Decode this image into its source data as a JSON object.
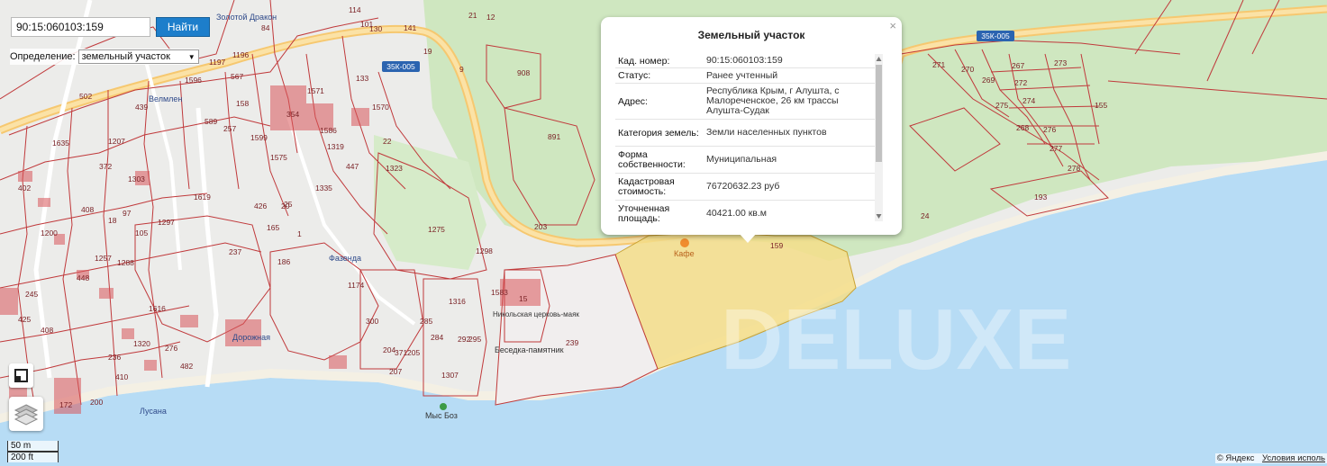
{
  "search": {
    "value": "90:15:060103:159",
    "button_label": "Найти"
  },
  "define": {
    "label": "Определение:",
    "selected": "земельный участок"
  },
  "popup": {
    "title": "Земельный участок",
    "close_symbol": "×",
    "rows": [
      {
        "label": "Кад. номер:",
        "value": "90:15:060103:159"
      },
      {
        "label": "Статус:",
        "value": "Ранее учтенный"
      },
      {
        "label": "Адрес:",
        "value": "Республика Крым, г Алушта, с Малореченское, 26 км трассы Алушта-Судак"
      },
      {
        "label": "Категория земель:",
        "value": "Земли населенных пунктов"
      },
      {
        "label": "Форма собственности:",
        "value": "Муниципальная"
      },
      {
        "label": "Кадастровая стоимость:",
        "value": "76720632.23 руб"
      },
      {
        "label": "Уточненная площадь:",
        "value": "40421.00 кв.м"
      }
    ]
  },
  "scale": {
    "metric": "50 m",
    "imperial": "200 ft"
  },
  "copyright": {
    "yandex": "© Яндекс",
    "terms": "Условия исполь"
  },
  "watermark": "DELUXE",
  "map_labels": {
    "roads": [
      "35К-005",
      "35К-005",
      "35К-005"
    ],
    "pois": [
      "Кафе",
      "Мыс Боз",
      "Беседка-памятник",
      "Никольская церковь-маяк",
      "Фазенда",
      "Дорожная",
      "Лусана",
      "Золотой Дракон",
      "Велмлен"
    ],
    "parcels": [
      "114",
      "12",
      "84",
      "141",
      "101",
      "155",
      "271",
      "270",
      "267",
      "273",
      "272",
      "269",
      "274",
      "275",
      "268",
      "276",
      "277",
      "278",
      "193",
      "24",
      "891",
      "908",
      "1275",
      "1298",
      "203",
      "1316",
      "1583",
      "295",
      "292",
      "285",
      "284",
      "204",
      "371",
      "205",
      "207",
      "1307",
      "239",
      "1174",
      "300",
      "237",
      "186",
      "1",
      "165",
      "426",
      "1323",
      "447",
      "1319",
      "1335",
      "25",
      "22",
      "1571",
      "1570",
      "1586",
      "1596",
      "1197",
      "1196",
      "567",
      "502",
      "439",
      "1635",
      "1207",
      "372",
      "1303",
      "402",
      "408",
      "1200",
      "1619",
      "1297",
      "105",
      "97",
      "1257",
      "1288",
      "18",
      "448",
      "245",
      "425",
      "408",
      "265",
      "1320",
      "1616",
      "410",
      "482",
      "276",
      "236",
      "200",
      "172",
      "257",
      "589",
      "158",
      "1599",
      "1575",
      "354",
      "20",
      "21",
      "9",
      "19",
      "133",
      "15",
      "130"
    ]
  }
}
